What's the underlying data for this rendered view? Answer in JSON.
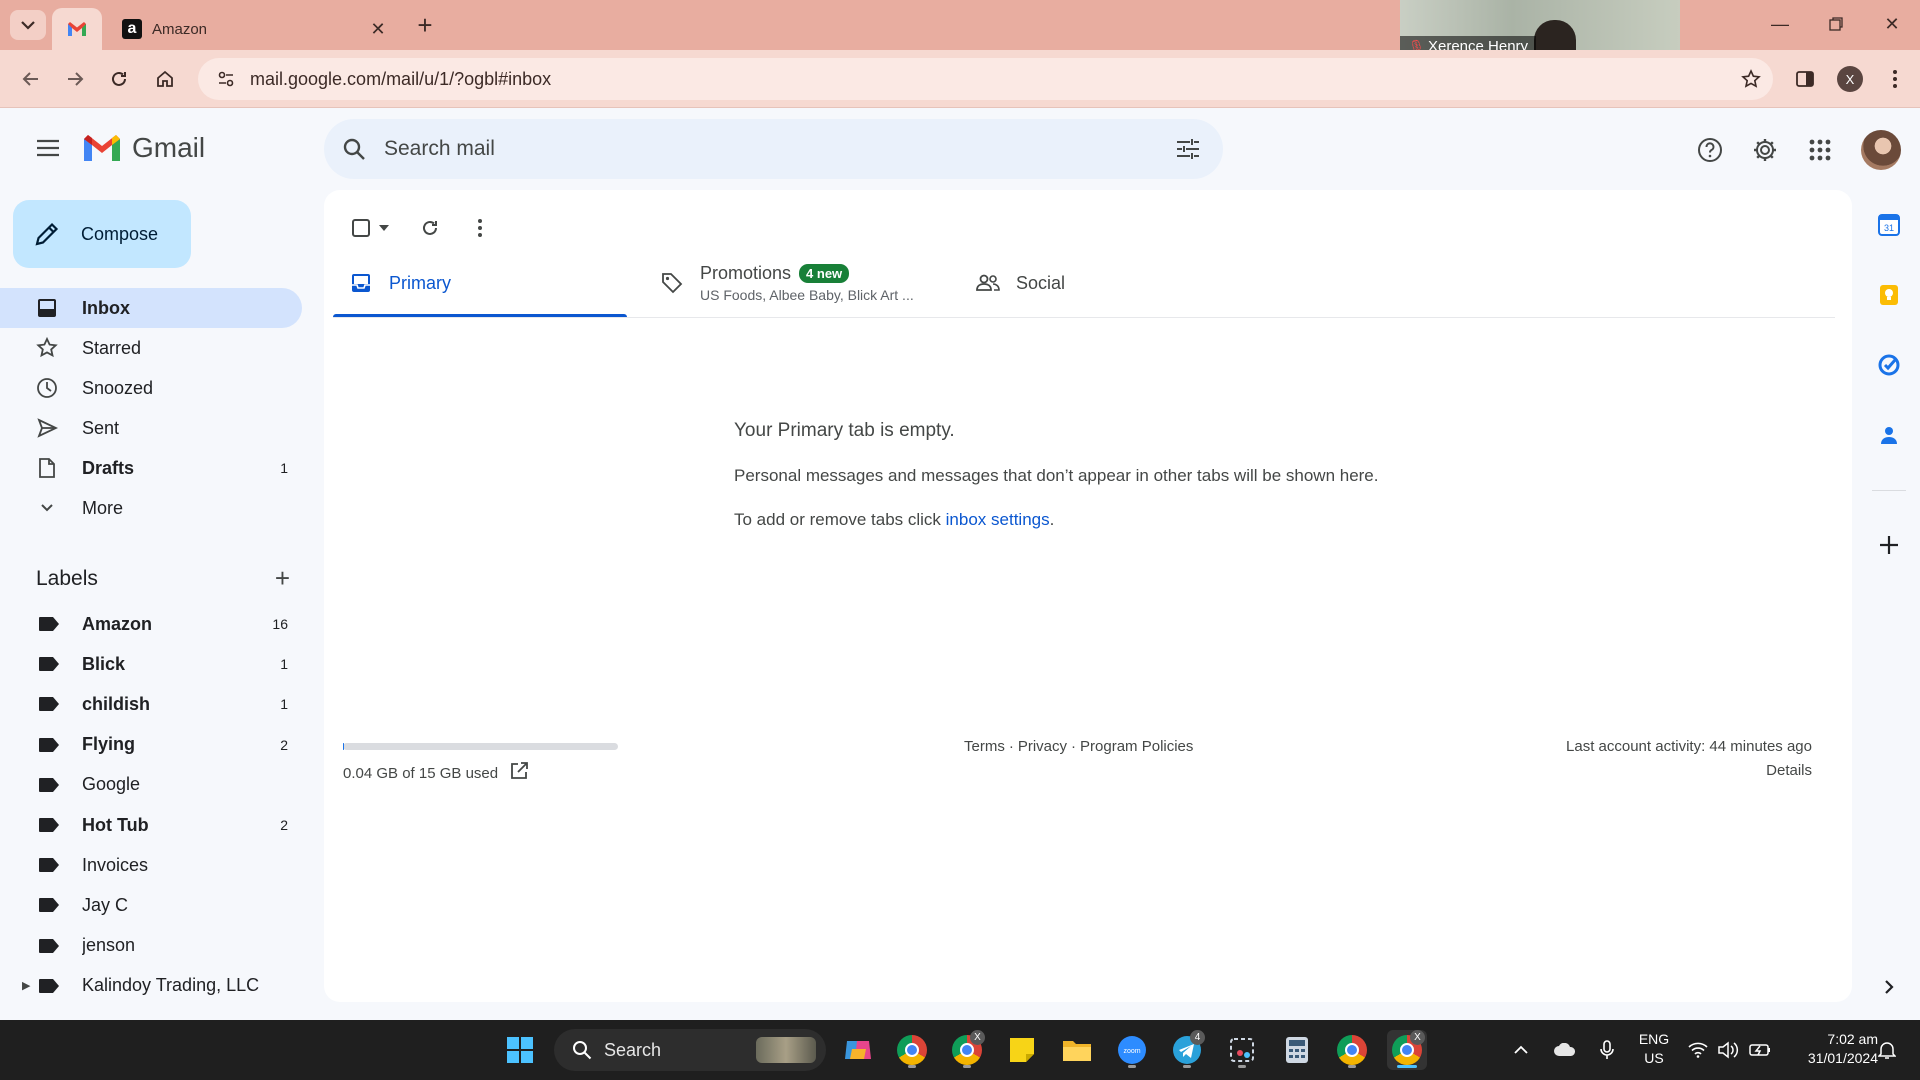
{
  "browser": {
    "tabs": [
      {
        "title": "",
        "favicon": "gmail-icon",
        "active": true
      },
      {
        "title": "Amazon",
        "favicon": "amazon-icon",
        "active": false
      }
    ],
    "url": "mail.google.com/mail/u/1/?ogbl#inbox",
    "profile_initial": "X",
    "zoom_participant": "Xerence Henry"
  },
  "gmail": {
    "brand": "Gmail",
    "search_placeholder": "Search mail",
    "compose_label": "Compose",
    "nav": [
      {
        "label": "Inbox",
        "icon": "inbox-icon",
        "count": "",
        "selected": true,
        "bold": true
      },
      {
        "label": "Starred",
        "icon": "star-icon",
        "count": "",
        "selected": false,
        "bold": false
      },
      {
        "label": "Snoozed",
        "icon": "clock-icon",
        "count": "",
        "selected": false,
        "bold": false
      },
      {
        "label": "Sent",
        "icon": "send-icon",
        "count": "",
        "selected": false,
        "bold": false
      },
      {
        "label": "Drafts",
        "icon": "draft-icon",
        "count": "1",
        "selected": false,
        "bold": true
      },
      {
        "label": "More",
        "icon": "chevron-down-icon",
        "count": "",
        "selected": false,
        "bold": false
      }
    ],
    "labels_heading": "Labels",
    "labels": [
      {
        "label": "Amazon",
        "count": "16",
        "bold": true
      },
      {
        "label": "Blick",
        "count": "1",
        "bold": true
      },
      {
        "label": "childish",
        "count": "1",
        "bold": true
      },
      {
        "label": "Flying",
        "count": "2",
        "bold": true
      },
      {
        "label": "Google",
        "count": "",
        "bold": false
      },
      {
        "label": "Hot Tub",
        "count": "2",
        "bold": true
      },
      {
        "label": "Invoices",
        "count": "",
        "bold": false
      },
      {
        "label": "Jay C",
        "count": "",
        "bold": false
      },
      {
        "label": "jenson",
        "count": "",
        "bold": false
      },
      {
        "label": "Kalindoy Trading, LLC - ...",
        "count": "",
        "bold": false
      }
    ],
    "tabs": {
      "primary": "Primary",
      "promotions": "Promotions",
      "promotions_badge": "4 new",
      "promotions_senders": "US Foods, Albee Baby, Blick Art ...",
      "social": "Social"
    },
    "empty": {
      "title": "Your Primary tab is empty.",
      "description": "Personal messages and messages that don’t appear in other tabs will be shown here.",
      "settings_prefix": "To add or remove tabs click ",
      "settings_link": "inbox settings",
      "settings_suffix": "."
    },
    "footer": {
      "storage_text": "0.04 GB of 15 GB used",
      "storage_fraction": 0.003,
      "terms": "Terms",
      "sep1": "·",
      "privacy": "Privacy",
      "sep2": "·",
      "policies": "Program Policies",
      "last_activity": "Last account activity: 44 minutes ago",
      "details": "Details"
    }
  },
  "taskbar": {
    "search_label": "Search",
    "telegram_badge": "4",
    "language": "ENG",
    "region": "US",
    "time": "7:02 am",
    "date": "31/01/2024"
  },
  "colors": {
    "accent": "#0b57d0",
    "compose_bg": "#c2e7ff",
    "selected_nav": "#d3e3fd",
    "badge_green": "#188038",
    "browser_frame": "#e8ada0"
  }
}
